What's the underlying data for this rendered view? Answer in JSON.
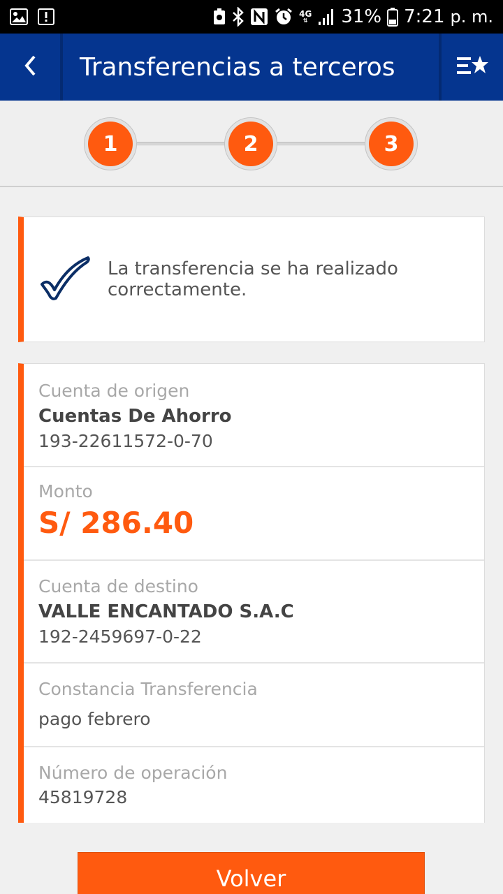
{
  "status_bar": {
    "network": "4G",
    "battery": "31%",
    "time": "7:21",
    "ampm": "p. m."
  },
  "app_bar": {
    "title": "Transferencias a terceros",
    "back_icon": "chevron-left-icon",
    "favorites_icon": "list-star-icon"
  },
  "stepper": {
    "steps": [
      "1",
      "2",
      "3"
    ],
    "accent_color": "#ff5a0f"
  },
  "success": {
    "message": "La transferencia se ha realizado correctamente.",
    "icon": "check-icon"
  },
  "details": {
    "origin": {
      "label": "Cuenta de origen",
      "name": "Cuentas De Ahorro",
      "number": "193-22611572-0-70"
    },
    "amount": {
      "label": "Monto",
      "value": "S/ 286.40"
    },
    "destination": {
      "label": "Cuenta de destino",
      "name": "VALLE ENCANTADO S.A.C",
      "number": "192-2459697-0-22"
    },
    "voucher": {
      "label": "Constancia Transferencia",
      "value": "pago febrero"
    },
    "operation": {
      "label": "Número de operación",
      "value": "45819728"
    }
  },
  "actions": {
    "back_label": "Volver"
  },
  "colors": {
    "brand_blue": "#05358f",
    "accent_orange": "#ff5a0f"
  }
}
